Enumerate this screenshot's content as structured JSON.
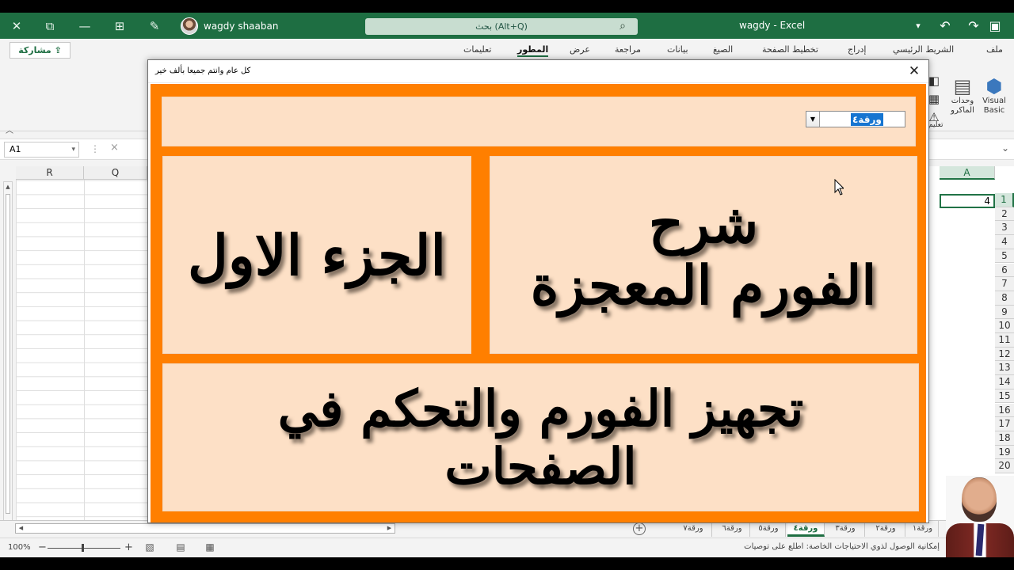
{
  "app": {
    "window_title": "wagdy  -  Excel",
    "user_name": "wagdy shaaban",
    "search_placeholder": "بحث (Alt+Q)",
    "window_buttons": [
      "—",
      "□",
      "✕"
    ]
  },
  "ribbon": {
    "share_label": "مشاركة",
    "tabs": [
      "ملف",
      "الشريط الرئيسي",
      "إدراج",
      "تخطيط الصفحة",
      "الصيغ",
      "بيانات",
      "مراجعة",
      "عرض",
      "المطور",
      "تعليمات"
    ],
    "active_tab": "المطور",
    "tools": {
      "visual_basic": "Visual\nBasic",
      "macros": "وحدات\nالماكرو",
      "group_label": "تعليم"
    }
  },
  "formula_bar": {
    "name_box": "A1",
    "cancel_icon": "×"
  },
  "sheet": {
    "left_columns": [
      "R",
      "Q"
    ],
    "right_column": "A",
    "active_value": "4",
    "rows": [
      "1",
      "2",
      "3",
      "4",
      "5",
      "6",
      "7",
      "8",
      "9",
      "10",
      "11",
      "12",
      "13",
      "14",
      "15",
      "16",
      "17",
      "18",
      "19",
      "20"
    ]
  },
  "sheet_tabs": {
    "active": "ورقة٤",
    "tabs": [
      "ورقة٧",
      "ورقة٦",
      "ورقة٥",
      "ورقة٤",
      "ورقة٣",
      "ورقة٢",
      "ورقة١"
    ]
  },
  "status_bar": {
    "zoom": "100%",
    "accessibility": "إمكانية الوصول لذوي الاحتياجات الخاصة: اطلع على توصيات"
  },
  "userform": {
    "caption": "كل عام وانتم جميعا بألف خير",
    "combo_value": "ورقة٤",
    "right_panel": [
      "شرح",
      "الفورم المعجزة"
    ],
    "left_panel": [
      "الجزء الاول"
    ],
    "bottom_panel": [
      "تجهيز الفورم والتحكم في",
      "الصفحات"
    ]
  },
  "colors": {
    "excel_green": "#1e6e42",
    "form_orange": "#ff7f00",
    "panel_peach": "#fde0c6",
    "combo_highlight": "#1675d1"
  }
}
